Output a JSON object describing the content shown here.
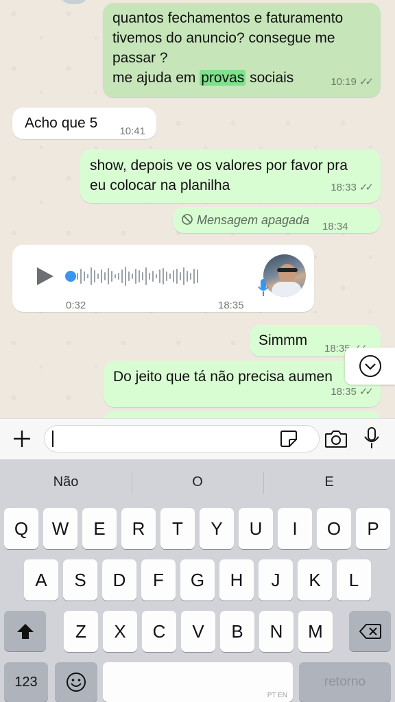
{
  "messages": {
    "m1": {
      "lines": [
        "quantos fechamentos e faturamento",
        "tivemos do anuncio? consegue me",
        "passar ?"
      ],
      "line4_before": "me ajuda em ",
      "line4_highlight": "provas",
      "line4_after": " sociais",
      "time": "10:19"
    },
    "m2": {
      "text": "Acho que 5",
      "time": "10:41"
    },
    "m3": {
      "lines": [
        "show, depois ve os valores por favor pra",
        "eu colocar na planilha"
      ],
      "time": "18:33"
    },
    "m4": {
      "text": "Mensagem apagada",
      "time": "18:34"
    },
    "voice": {
      "duration": "0:32",
      "time": "18:35"
    },
    "m5": {
      "text": "Simmm",
      "time": "18:35"
    },
    "m6": {
      "text": "Do jeito que tá não precisa aumen",
      "time": "18:35"
    }
  },
  "keyboard": {
    "suggestions": [
      "Não",
      "O",
      "E"
    ],
    "row1": [
      "Q",
      "W",
      "E",
      "R",
      "T",
      "Y",
      "U",
      "I",
      "O",
      "P"
    ],
    "row2": [
      "A",
      "S",
      "D",
      "F",
      "G",
      "H",
      "J",
      "K",
      "L"
    ],
    "row3": [
      "Z",
      "X",
      "C",
      "V",
      "B",
      "N",
      "M"
    ],
    "numbers": "123",
    "return": "retorno",
    "lang": "PT EN"
  },
  "icons": [
    "plus-icon",
    "sticker-icon",
    "camera-icon",
    "mic-icon",
    "play-icon",
    "scroll-down-icon",
    "shift-icon",
    "backspace-icon",
    "emoji-icon",
    "deleted-icon",
    "double-check-icon"
  ]
}
